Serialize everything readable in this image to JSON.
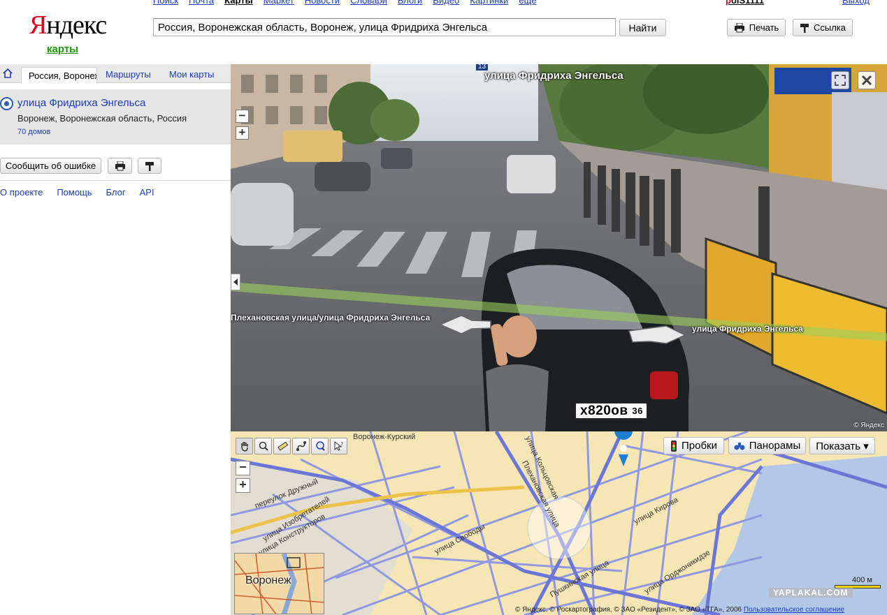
{
  "header": {
    "logo_ya": "Я",
    "logo_rest": "ндекс",
    "logo_sub": "карты",
    "nav": [
      "Поиск",
      "Почта",
      "Карты",
      "Маркет",
      "Новости",
      "Словари",
      "Блоги",
      "Видео",
      "Картинки",
      "ещё"
    ],
    "nav_current": "Карты",
    "user_first": "p",
    "user_rest": "olS1111",
    "logout": "Выход",
    "search_value": "Россия, Воронежская область, Воронеж, улица Фридриха Энгельса",
    "search_button": "Найти",
    "print_button": "Печать",
    "link_button": "Ссылка"
  },
  "left_panel": {
    "tab_active": "Россия, Воронеж",
    "tab_routes": "Маршруты",
    "tab_mymaps": "Мои карты",
    "result_title": "улица Фридриха Энгельса",
    "result_address": "Воронеж, Воронежская область, Россия",
    "result_houses": "70 домов",
    "report_button": "Сообщить об ошибке",
    "footer_links": [
      "О проекте",
      "Помощь",
      "Блог",
      "API"
    ]
  },
  "panorama": {
    "badge": "13",
    "street_title": "улица Фридриха Энгельса",
    "label_left": "Плехановская улица/улица Фридриха Энгельса",
    "label_right": "улица Фридриха Энгельса",
    "plate": "х820ов",
    "plate_region": "36",
    "copyright": "© Яндекс"
  },
  "map": {
    "traffic_button": "Пробки",
    "panoramas_button": "Панорамы",
    "show_button": "Показать ▾",
    "streets": [
      "Воронеж-Курский",
      "Плехановская улица",
      "улица Свободы",
      "переулок Дружный",
      "улица Изобретателей",
      "улица Конструкторов",
      "улица Кольцовская",
      "Пушкинская улица",
      "улица Кирова",
      "улица Орджоникидзе"
    ],
    "minimap_label": "Воронеж",
    "scale": "400 м",
    "copyright": "© Яндекс, © Роскартография, © ЗАО «Резидент», © ЗАО «ТГА», 2006",
    "agreement": "Пользовательское соглашение",
    "watermark": "YAPLAKAL.COM"
  },
  "colors": {
    "brand_red": "#e2001a",
    "link_blue": "#1a3dc1",
    "logo_green": "#1a9a00",
    "map_bg": "#f6e6b5",
    "road_blue": "#6b77d6",
    "water": "#b3c8e6"
  }
}
